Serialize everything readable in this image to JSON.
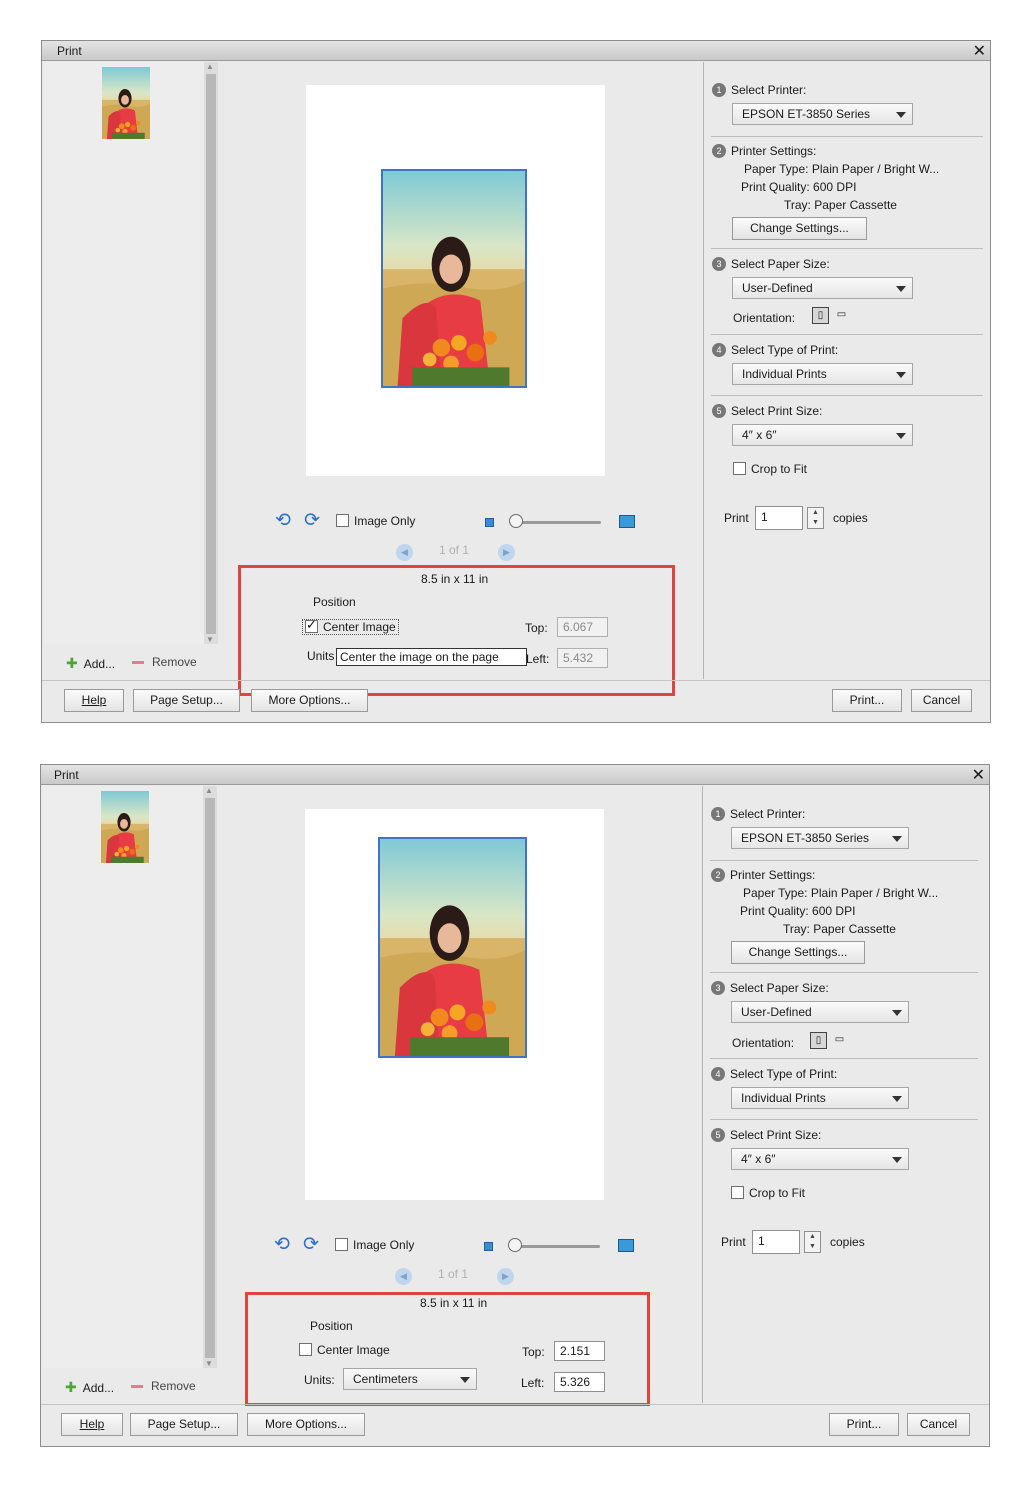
{
  "dialogs": [
    {
      "title": "Print",
      "paper_size": "8.5 in x 11 in",
      "image_only": "Image Only",
      "page_indicator": "1 of 1",
      "position": {
        "heading": "Position",
        "center_image": "Center Image",
        "center_image_checked": true,
        "tooltip": "Center the image on the page",
        "units_label": "Units",
        "top_label": "Top:",
        "top_value": "6.067",
        "left_label": "Left:",
        "left_value": "5.432"
      },
      "add": "Add...",
      "remove": "Remove",
      "buttons": {
        "help": "Help",
        "page_setup": "Page Setup...",
        "more_options": "More Options...",
        "print": "Print...",
        "cancel": "Cancel"
      },
      "settings": {
        "select_printer": "Select Printer:",
        "printer": "EPSON ET-3850 Series",
        "printer_settings": "Printer Settings:",
        "paper_type_label": "Paper Type:",
        "paper_type": "Plain Paper / Bright W...",
        "print_quality_label": "Print Quality:",
        "print_quality": "600 DPI",
        "tray_label": "Tray:",
        "tray": "Paper Cassette",
        "change_settings": "Change Settings...",
        "select_paper_size": "Select Paper Size:",
        "paper_size": "User-Defined",
        "orientation": "Orientation:",
        "select_type": "Select Type of Print:",
        "type": "Individual Prints",
        "select_print_size": "Select Print Size:",
        "print_size": "4″ x 6″",
        "crop_to_fit": "Crop to Fit",
        "print_label": "Print",
        "copies_value": "1",
        "copies_label": "copies"
      }
    },
    {
      "title": "Print",
      "paper_size": "8.5 in x 11 in",
      "image_only": "Image Only",
      "page_indicator": "1 of 1",
      "position": {
        "heading": "Position",
        "center_image": "Center Image",
        "center_image_checked": false,
        "units_label": "Units:",
        "units_value": "Centimeters",
        "top_label": "Top:",
        "top_value": "2.151",
        "left_label": "Left:",
        "left_value": "5.326"
      },
      "add": "Add...",
      "remove": "Remove",
      "buttons": {
        "help": "Help",
        "page_setup": "Page Setup...",
        "more_options": "More Options...",
        "print": "Print...",
        "cancel": "Cancel"
      },
      "settings": {
        "select_printer": "Select Printer:",
        "printer": "EPSON ET-3850 Series",
        "printer_settings": "Printer Settings:",
        "paper_type_label": "Paper Type:",
        "paper_type": "Plain Paper / Bright W...",
        "print_quality_label": "Print Quality:",
        "print_quality": "600 DPI",
        "tray_label": "Tray:",
        "tray": "Paper Cassette",
        "change_settings": "Change Settings...",
        "select_paper_size": "Select Paper Size:",
        "paper_size": "User-Defined",
        "orientation": "Orientation:",
        "select_type": "Select Type of Print:",
        "type": "Individual Prints",
        "select_print_size": "Select Print Size:",
        "print_size": "4″ x 6″",
        "crop_to_fit": "Crop to Fit",
        "print_label": "Print",
        "copies_value": "1",
        "copies_label": "copies"
      }
    }
  ],
  "icons": [
    "close-icon",
    "rotate-left-icon",
    "rotate-right-icon",
    "prev-page-icon",
    "next-page-icon",
    "add-icon",
    "remove-icon",
    "portrait-icon",
    "landscape-icon",
    "dropdown-arrow-icon"
  ],
  "colors": {
    "highlight_box": "#e0443e",
    "photo_border": "#3f73c8",
    "dialog_bg": "#eaeaea",
    "slider_accent": "#3a9ad9"
  }
}
